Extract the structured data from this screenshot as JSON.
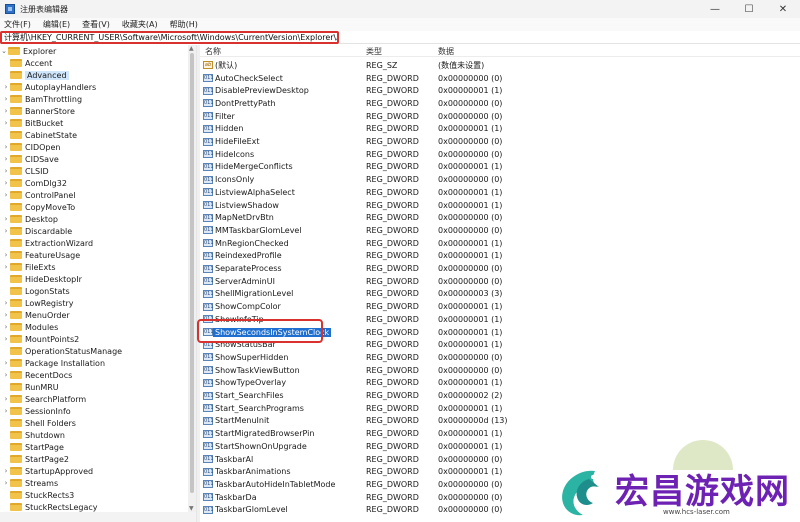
{
  "window": {
    "title": "注册表编辑器",
    "controls": {
      "minimize": "—",
      "maximize": "☐",
      "close": "✕"
    }
  },
  "menu": [
    "文件(F)",
    "编辑(E)",
    "查看(V)",
    "收藏夹(A)",
    "帮助(H)"
  ],
  "address": "计算机\\HKEY_CURRENT_USER\\Software\\Microsoft\\Windows\\CurrentVersion\\Explorer\\Advanced",
  "tree": {
    "root": "Explorer",
    "items": [
      {
        "label": "Accent",
        "expandable": false
      },
      {
        "label": "Advanced",
        "expandable": false,
        "selected": true
      },
      {
        "label": "AutoplayHandlers",
        "expandable": true
      },
      {
        "label": "BamThrottling",
        "expandable": true
      },
      {
        "label": "BannerStore",
        "expandable": true
      },
      {
        "label": "BitBucket",
        "expandable": true
      },
      {
        "label": "CabinetState",
        "expandable": false
      },
      {
        "label": "CIDOpen",
        "expandable": true
      },
      {
        "label": "CIDSave",
        "expandable": true
      },
      {
        "label": "CLSID",
        "expandable": true
      },
      {
        "label": "ComDlg32",
        "expandable": true
      },
      {
        "label": "ControlPanel",
        "expandable": true
      },
      {
        "label": "CopyMoveTo",
        "expandable": false
      },
      {
        "label": "Desktop",
        "expandable": true
      },
      {
        "label": "Discardable",
        "expandable": true
      },
      {
        "label": "ExtractionWizard",
        "expandable": false
      },
      {
        "label": "FeatureUsage",
        "expandable": true
      },
      {
        "label": "FileExts",
        "expandable": true
      },
      {
        "label": "HideDesktopIr",
        "expandable": false
      },
      {
        "label": "LogonStats",
        "expandable": false
      },
      {
        "label": "LowRegistry",
        "expandable": true
      },
      {
        "label": "MenuOrder",
        "expandable": true
      },
      {
        "label": "Modules",
        "expandable": true
      },
      {
        "label": "MountPoints2",
        "expandable": true
      },
      {
        "label": "OperationStatusManage",
        "expandable": false
      },
      {
        "label": "Package Installation",
        "expandable": true
      },
      {
        "label": "RecentDocs",
        "expandable": true
      },
      {
        "label": "RunMRU",
        "expandable": false
      },
      {
        "label": "SearchPlatform",
        "expandable": true
      },
      {
        "label": "SessionInfo",
        "expandable": true
      },
      {
        "label": "Shell Folders",
        "expandable": false
      },
      {
        "label": "Shutdown",
        "expandable": false
      },
      {
        "label": "StartPage",
        "expandable": false
      },
      {
        "label": "StartPage2",
        "expandable": false
      },
      {
        "label": "StartupApproved",
        "expandable": true
      },
      {
        "label": "Streams",
        "expandable": true
      },
      {
        "label": "StuckRects3",
        "expandable": false
      },
      {
        "label": "StuckRectsLegacy",
        "expandable": false
      }
    ]
  },
  "columns": {
    "name": "名称",
    "type": "类型",
    "data": "数据"
  },
  "values": [
    {
      "name": "(默认)",
      "type": "REG_SZ",
      "data": "(数值未设置)",
      "icon": "ab"
    },
    {
      "name": "AutoCheckSelect",
      "type": "REG_DWORD",
      "data": "0x00000000 (0)",
      "icon": "dw"
    },
    {
      "name": "DisablePreviewDesktop",
      "type": "REG_DWORD",
      "data": "0x00000001 (1)",
      "icon": "dw"
    },
    {
      "name": "DontPrettyPath",
      "type": "REG_DWORD",
      "data": "0x00000000 (0)",
      "icon": "dw"
    },
    {
      "name": "Filter",
      "type": "REG_DWORD",
      "data": "0x00000000 (0)",
      "icon": "dw"
    },
    {
      "name": "Hidden",
      "type": "REG_DWORD",
      "data": "0x00000001 (1)",
      "icon": "dw"
    },
    {
      "name": "HideFileExt",
      "type": "REG_DWORD",
      "data": "0x00000000 (0)",
      "icon": "dw"
    },
    {
      "name": "HideIcons",
      "type": "REG_DWORD",
      "data": "0x00000000 (0)",
      "icon": "dw"
    },
    {
      "name": "HideMergeConflicts",
      "type": "REG_DWORD",
      "data": "0x00000001 (1)",
      "icon": "dw"
    },
    {
      "name": "IconsOnly",
      "type": "REG_DWORD",
      "data": "0x00000000 (0)",
      "icon": "dw"
    },
    {
      "name": "ListviewAlphaSelect",
      "type": "REG_DWORD",
      "data": "0x00000001 (1)",
      "icon": "dw"
    },
    {
      "name": "ListviewShadow",
      "type": "REG_DWORD",
      "data": "0x00000001 (1)",
      "icon": "dw"
    },
    {
      "name": "MapNetDrvBtn",
      "type": "REG_DWORD",
      "data": "0x00000000 (0)",
      "icon": "dw"
    },
    {
      "name": "MMTaskbarGlomLevel",
      "type": "REG_DWORD",
      "data": "0x00000000 (0)",
      "icon": "dw"
    },
    {
      "name": "MnRegionChecked",
      "type": "REG_DWORD",
      "data": "0x00000001 (1)",
      "icon": "dw"
    },
    {
      "name": "ReindexedProfile",
      "type": "REG_DWORD",
      "data": "0x00000001 (1)",
      "icon": "dw"
    },
    {
      "name": "SeparateProcess",
      "type": "REG_DWORD",
      "data": "0x00000000 (0)",
      "icon": "dw"
    },
    {
      "name": "ServerAdminUI",
      "type": "REG_DWORD",
      "data": "0x00000000 (0)",
      "icon": "dw"
    },
    {
      "name": "ShellMigrationLevel",
      "type": "REG_DWORD",
      "data": "0x00000003 (3)",
      "icon": "dw"
    },
    {
      "name": "ShowCompColor",
      "type": "REG_DWORD",
      "data": "0x00000001 (1)",
      "icon": "dw"
    },
    {
      "name": "ShowInfoTip",
      "type": "REG_DWORD",
      "data": "0x00000001 (1)",
      "icon": "dw"
    },
    {
      "name": "ShowSecondsInSystemClock",
      "type": "REG_DWORD",
      "data": "0x00000001 (1)",
      "icon": "dw",
      "selected": true
    },
    {
      "name": "ShowStatusBar",
      "type": "REG_DWORD",
      "data": "0x00000001 (1)",
      "icon": "dw"
    },
    {
      "name": "ShowSuperHidden",
      "type": "REG_DWORD",
      "data": "0x00000000 (0)",
      "icon": "dw"
    },
    {
      "name": "ShowTaskViewButton",
      "type": "REG_DWORD",
      "data": "0x00000000 (0)",
      "icon": "dw"
    },
    {
      "name": "ShowTypeOverlay",
      "type": "REG_DWORD",
      "data": "0x00000001 (1)",
      "icon": "dw"
    },
    {
      "name": "Start_SearchFiles",
      "type": "REG_DWORD",
      "data": "0x00000002 (2)",
      "icon": "dw"
    },
    {
      "name": "Start_SearchPrograms",
      "type": "REG_DWORD",
      "data": "0x00000001 (1)",
      "icon": "dw"
    },
    {
      "name": "StartMenuInit",
      "type": "REG_DWORD",
      "data": "0x0000000d (13)",
      "icon": "dw"
    },
    {
      "name": "StartMigratedBrowserPin",
      "type": "REG_DWORD",
      "data": "0x00000001 (1)",
      "icon": "dw"
    },
    {
      "name": "StartShownOnUpgrade",
      "type": "REG_DWORD",
      "data": "0x00000001 (1)",
      "icon": "dw"
    },
    {
      "name": "TaskbarAl",
      "type": "REG_DWORD",
      "data": "0x00000000 (0)",
      "icon": "dw"
    },
    {
      "name": "TaskbarAnimations",
      "type": "REG_DWORD",
      "data": "0x00000001 (1)",
      "icon": "dw"
    },
    {
      "name": "TaskbarAutoHideInTabletMode",
      "type": "REG_DWORD",
      "data": "0x00000000 (0)",
      "icon": "dw"
    },
    {
      "name": "TaskbarDa",
      "type": "REG_DWORD",
      "data": "0x00000000 (0)",
      "icon": "dw"
    },
    {
      "name": "TaskbarGlomLevel",
      "type": "REG_DWORD",
      "data": "0x00000000 (0)",
      "icon": "dw"
    }
  ],
  "watermark": {
    "brand": "宏昌游戏网",
    "url": "www.hcs-laser.com"
  },
  "colors": {
    "highlight_border": "#d8312e",
    "selection": "#1f6fd1",
    "folder": "#f1c34b",
    "brand": "#6d22b3"
  }
}
